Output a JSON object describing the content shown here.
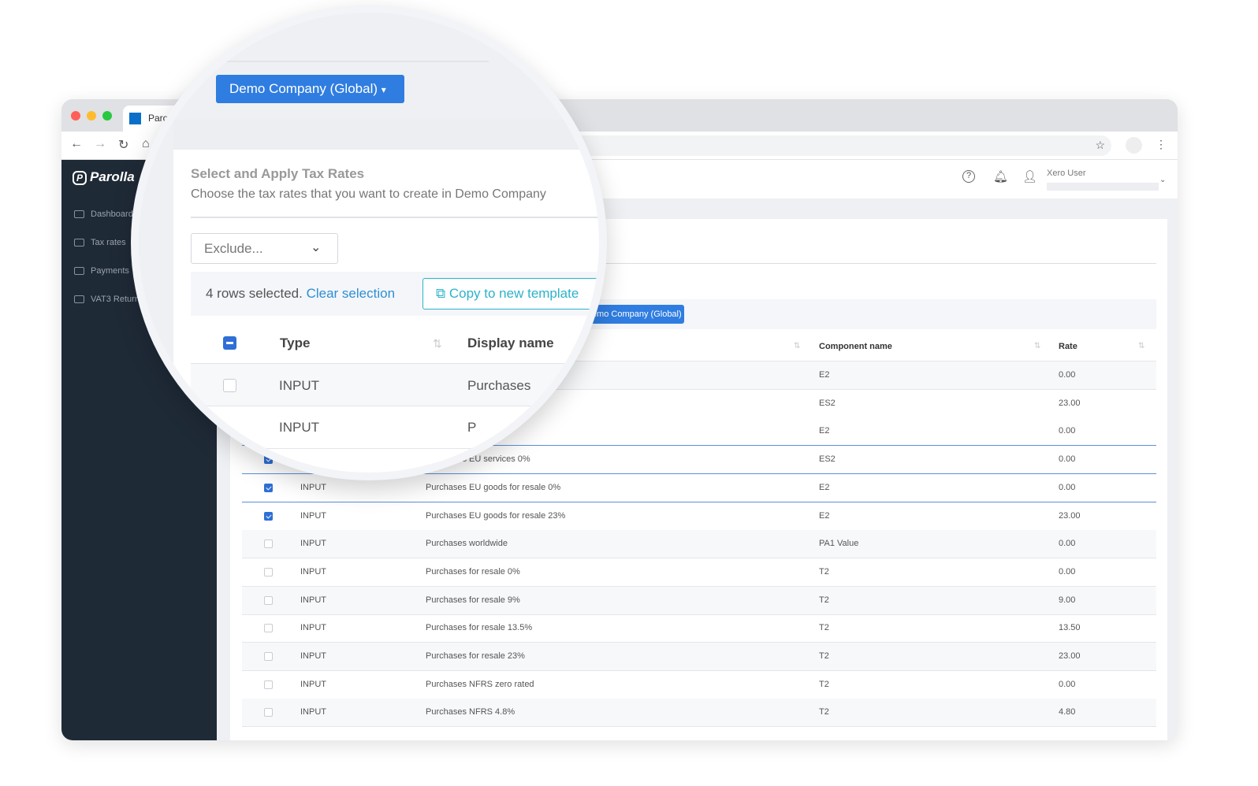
{
  "browser": {
    "tab_title": "Parolla",
    "colors": {
      "close": "#ff5f57",
      "min": "#febc2e",
      "max": "#28c840"
    }
  },
  "app": {
    "logo": "Parolla",
    "user_name": "Xero User"
  },
  "sidebar": {
    "items": [
      {
        "label": "Dashboard",
        "icon": "monitor-icon"
      },
      {
        "label": "Tax rates",
        "icon": "folder-gear-icon"
      },
      {
        "label": "Payments",
        "icon": "cash-icon"
      },
      {
        "label": "VAT3 Returns",
        "icon": "document-icon"
      }
    ]
  },
  "main": {
    "company_button": "Demo Company (Global)",
    "title": "Select and Apply Tax Rates",
    "subtitle": "Choose the tax rates that you want to create in Demo Company",
    "exclude_placeholder": "Exclude...",
    "selection_text": "4 rows selected.",
    "clear_selection": "Clear selection",
    "copy_button": "Copy to new template",
    "columns": [
      "Type",
      "Display name",
      "Component name",
      "Rate"
    ],
    "rows": [
      {
        "checked": false,
        "type": "INPUT",
        "display": "Purchases",
        "component": "E2",
        "rate": "0.00"
      },
      {
        "checked": false,
        "type": "INPUT",
        "display": "",
        "component": "ES2",
        "rate": "23.00"
      },
      {
        "checked": true,
        "type": "INPUT",
        "display": "",
        "component": "E2",
        "rate": "0.00"
      },
      {
        "checked": true,
        "type": "INPUT",
        "display": "Purchases EU services 0%",
        "component": "ES2",
        "rate": "0.00"
      },
      {
        "checked": true,
        "type": "INPUT",
        "display": "Purchases EU goods for resale 0%",
        "component": "E2",
        "rate": "0.00"
      },
      {
        "checked": true,
        "type": "INPUT",
        "display": "Purchases EU goods for resale 23%",
        "component": "E2",
        "rate": "23.00"
      },
      {
        "checked": false,
        "type": "INPUT",
        "display": "Purchases worldwide",
        "component": "PA1 Value",
        "rate": "0.00"
      },
      {
        "checked": false,
        "type": "INPUT",
        "display": "Purchases for resale 0%",
        "component": "T2",
        "rate": "0.00"
      },
      {
        "checked": false,
        "type": "INPUT",
        "display": "Purchases for resale 9%",
        "component": "T2",
        "rate": "9.00"
      },
      {
        "checked": false,
        "type": "INPUT",
        "display": "Purchases for resale 13.5%",
        "component": "T2",
        "rate": "13.50"
      },
      {
        "checked": false,
        "type": "INPUT",
        "display": "Purchases for resale 23%",
        "component": "T2",
        "rate": "23.00"
      },
      {
        "checked": false,
        "type": "INPUT",
        "display": "Purchases NFRS zero rated",
        "component": "T2",
        "rate": "0.00"
      },
      {
        "checked": false,
        "type": "INPUT",
        "display": "Purchases NFRS 4.8%",
        "component": "T2",
        "rate": "4.80"
      }
    ]
  },
  "colors": {
    "primary": "#2f7de1",
    "teal": "#2bb3c9",
    "sidebar": "#1f2a37"
  }
}
